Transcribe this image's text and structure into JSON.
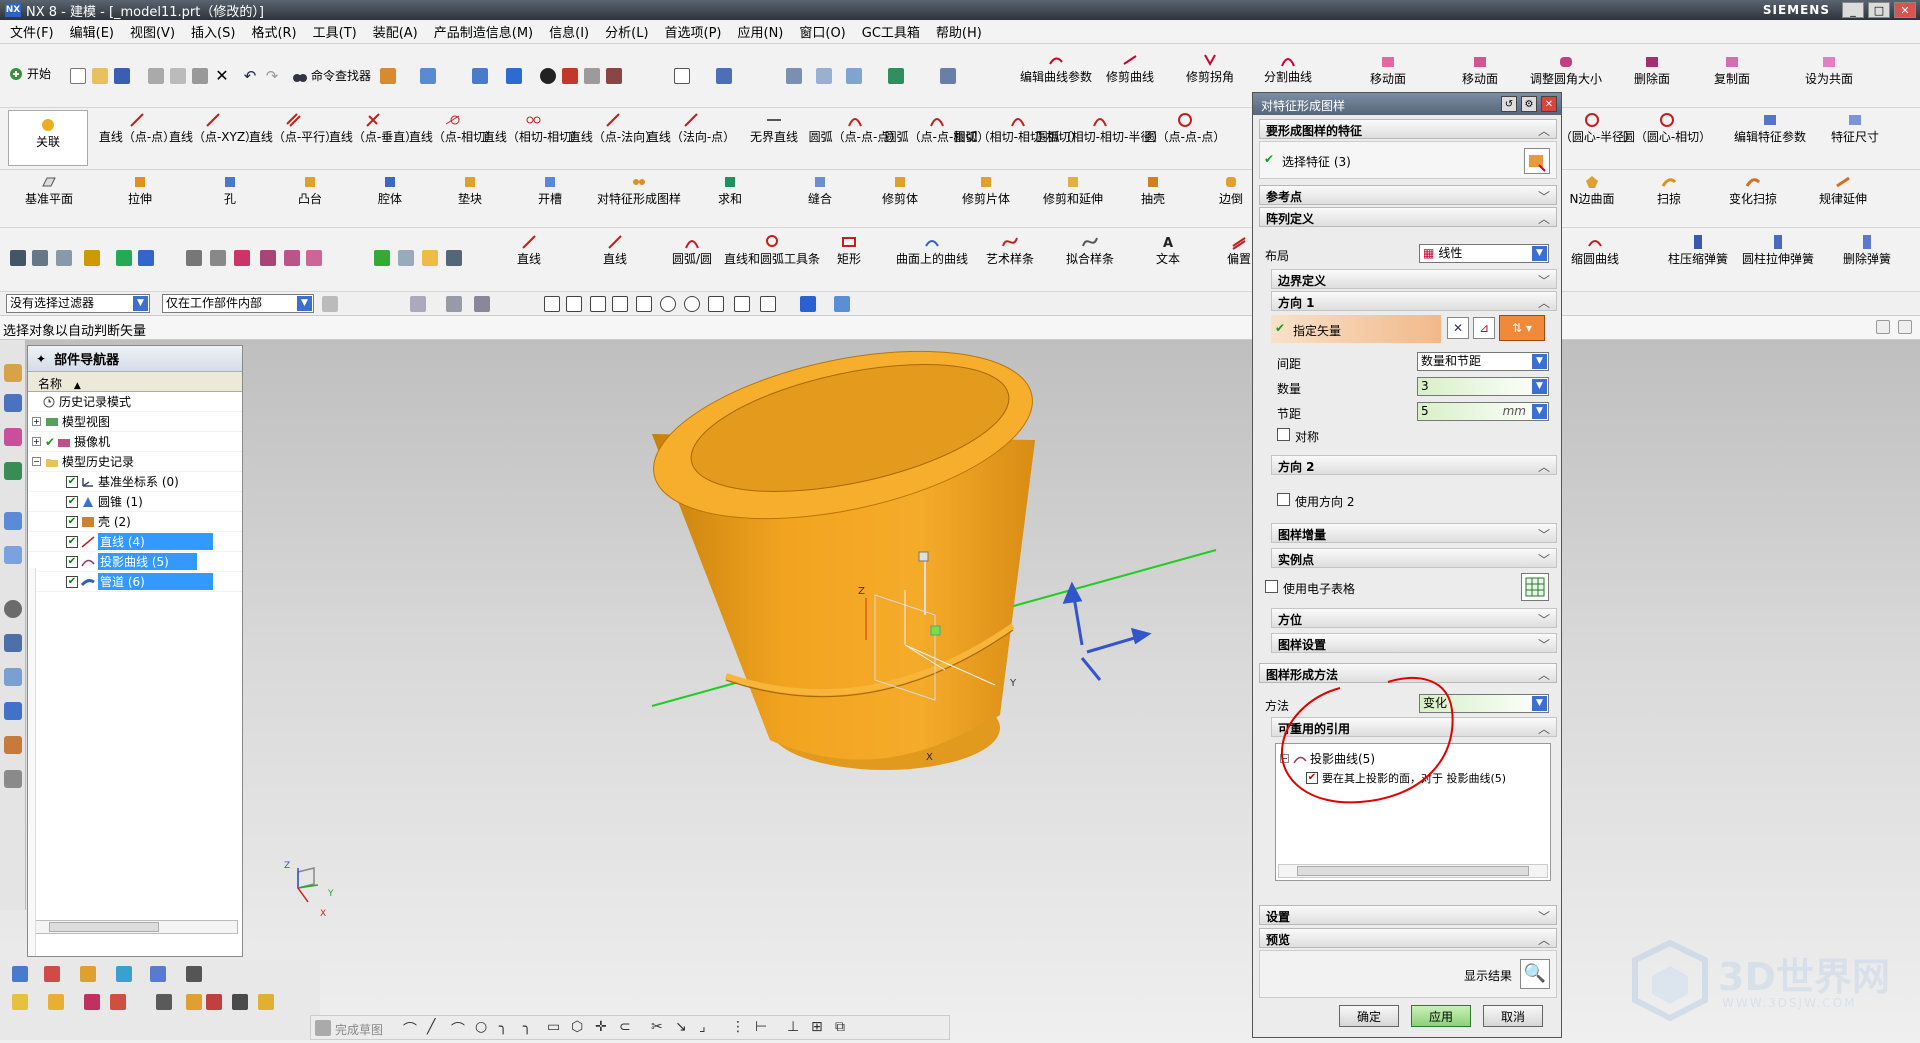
{
  "window": {
    "app_icon": "NX",
    "title": "NX 8 - 建模 - [_model11.prt（修改的）]",
    "brand": "SIEMENS",
    "controls": [
      "_",
      "□",
      "✕"
    ]
  },
  "menu": [
    "文件(F)",
    "编辑(E)",
    "视图(V)",
    "插入(S)",
    "格式(R)",
    "工具(T)",
    "装配(A)",
    "产品制造信息(M)",
    "信息(I)",
    "分析(L)",
    "首选项(P)",
    "应用(N)",
    "窗口(O)",
    "GC工具箱",
    "帮助(H)"
  ],
  "toolbar1": {
    "start": "开始",
    "finder": "命令查找器",
    "right": [
      "编辑曲线参数",
      "修剪曲线",
      "修剪拐角",
      "分割曲线",
      "移动面",
      "移动面",
      "调整圆角大小",
      "删除面",
      "复制面",
      "设为共面"
    ]
  },
  "toolbar2": [
    "关联",
    "直线（点-点）",
    "直线（点-XYZ）",
    "直线（点-平行）",
    "直线（点-垂直）",
    "直线（点-相切）",
    "直线（相切-相切）",
    "直线（点-法向）",
    "直线（法向-点）",
    "无界直线",
    "圆弧（点-点-点）",
    "圆弧（点-点-相切）",
    "圆弧（相切-相切-相切）",
    "圆弧（相切-相切-半径）",
    "圆（点-点-点）",
    "圆（圆心-半径）",
    "圆（圆心-相切）",
    "编辑特征参数",
    "特征尺寸"
  ],
  "toolbar3": [
    "基准平面",
    "拉伸",
    "孔",
    "凸台",
    "腔体",
    "垫块",
    "开槽",
    "对特征形成图样",
    "求和",
    "缝合",
    "修剪体",
    "修剪片体",
    "修剪和延伸",
    "抽壳",
    "边倒",
    "N边曲面",
    "扫掠",
    "变化扫掠",
    "规律延伸"
  ],
  "toolbar4": [
    "直线",
    "直线",
    "圆弧/圆",
    "直线和圆弧工具条",
    "矩形",
    "曲面上的曲线",
    "艺术样条",
    "拟合样条",
    "文本",
    "偏置",
    "缩圆曲线",
    "柱压缩弹簧",
    "圆柱拉伸弹簧",
    "删除弹簧"
  ],
  "selection": {
    "filter": "没有选择过滤器",
    "scope": "仅在工作部件内部"
  },
  "cue": "选择对象以自动判断矢量",
  "navigator": {
    "title": "部件导航器",
    "column": "名称",
    "rows": [
      {
        "label": "历史记录模式",
        "indent": 1,
        "checked": false,
        "selected": false
      },
      {
        "label": "模型视图",
        "indent": 0,
        "checked": false,
        "selected": false
      },
      {
        "label": "摄像机",
        "indent": 0,
        "checked": true,
        "selected": false
      },
      {
        "label": "模型历史记录",
        "indent": 0,
        "checked": false,
        "selected": false
      },
      {
        "label": "基准坐标系 (0)",
        "indent": 2,
        "checked": true,
        "selected": false
      },
      {
        "label": "圆锥 (1)",
        "indent": 2,
        "checked": true,
        "selected": false
      },
      {
        "label": "壳 (2)",
        "indent": 2,
        "checked": true,
        "selected": false
      },
      {
        "label": "直线 (4)",
        "indent": 2,
        "checked": true,
        "selected": true
      },
      {
        "label": "投影曲线 (5)",
        "indent": 2,
        "checked": true,
        "selected": true
      },
      {
        "label": "管道 (6)",
        "indent": 2,
        "checked": true,
        "selected": true
      }
    ]
  },
  "bottom": {
    "sketch_finish": "完成草图"
  },
  "dialog": {
    "title": "对特征形成图样",
    "sec_feature": "要形成图样的特征",
    "select_feature": "选择特征 (3)",
    "sec_ref": "参考点",
    "sec_array": "阵列定义",
    "layout_label": "布局",
    "layout_value": "线性",
    "sec_boundary": "边界定义",
    "sec_dir1": "方向 1",
    "specify_vector": "指定矢量",
    "spacing_label": "间距",
    "spacing_value": "数量和节距",
    "count_label": "数量",
    "count_value": "3",
    "pitch_label": "节距",
    "pitch_value": "5",
    "pitch_unit": "mm",
    "symmetric": "对称",
    "sec_dir2": "方向 2",
    "use_dir2": "使用方向 2",
    "sec_increment": "图样增量",
    "sec_instance": "实例点",
    "use_spreadsheet": "使用电子表格",
    "sec_orientation": "方位",
    "sec_pattern_settings": "图样设置",
    "sec_method": "图样形成方法",
    "method_label": "方法",
    "method_value": "变化",
    "sec_reuse": "可重用的引用",
    "tree_parent": "投影曲线(5)",
    "tree_child": "要在其上投影的面，对于 投影曲线(5)",
    "sec_settings": "设置",
    "sec_preview": "预览",
    "show_result": "显示结果",
    "ok": "确定",
    "apply": "应用",
    "cancel": "取消"
  },
  "watermark": {
    "text": "3D世界网",
    "url": "WWW.3DSJW.COM"
  },
  "colors": {
    "model": "#f0a020",
    "highlight": "#3399ff",
    "annotation": "#e00000",
    "axis_green": "#22cc22",
    "axis_blue": "#3355cc"
  }
}
